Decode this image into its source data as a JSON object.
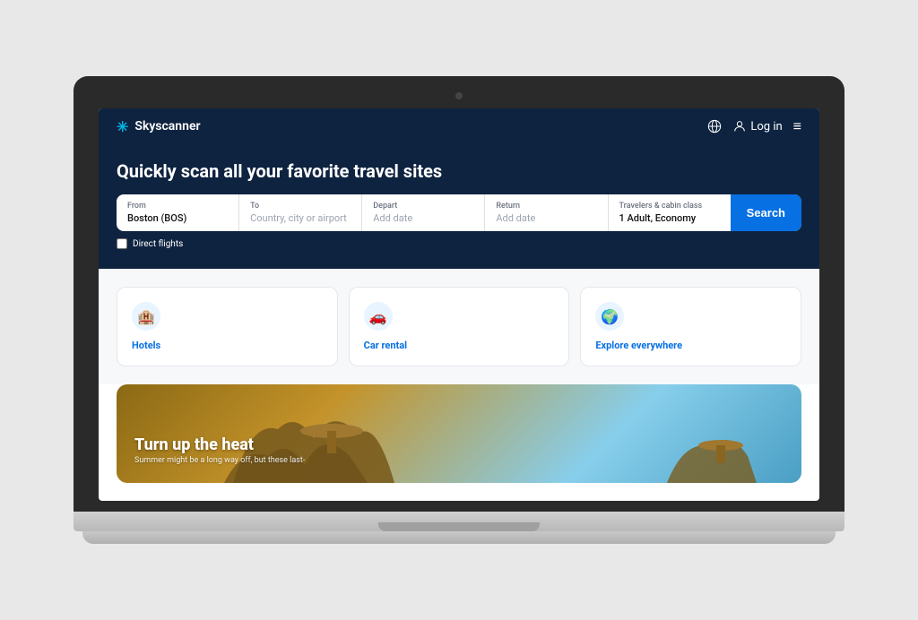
{
  "laptop": {
    "camera_label": "camera"
  },
  "nav": {
    "logo_text": "Skyscanner",
    "login_label": "Log in",
    "globe_icon": "🌐",
    "person_icon": "👤",
    "menu_icon": "≡"
  },
  "hero": {
    "title": "Quickly scan all your favorite travel sites"
  },
  "search": {
    "from_label": "From",
    "from_value": "Boston (BOS)",
    "to_label": "To",
    "to_placeholder": "Country, city or airport",
    "depart_label": "Depart",
    "depart_placeholder": "Add date",
    "return_label": "Return",
    "return_placeholder": "Add date",
    "travelers_label": "Travelers & cabin class",
    "travelers_value": "1 Adult, Economy",
    "button_label": "Search",
    "direct_flights_label": "Direct flights"
  },
  "categories": [
    {
      "id": "hotels",
      "icon": "🏨",
      "label": "Hotels"
    },
    {
      "id": "car-rental",
      "icon": "🚗",
      "label": "Car rental"
    },
    {
      "id": "explore",
      "icon": "🌍",
      "label": "Explore everywhere"
    }
  ],
  "promo": {
    "title": "Turn up the heat",
    "subtitle": "Summer might be a long way off, but these last-"
  }
}
